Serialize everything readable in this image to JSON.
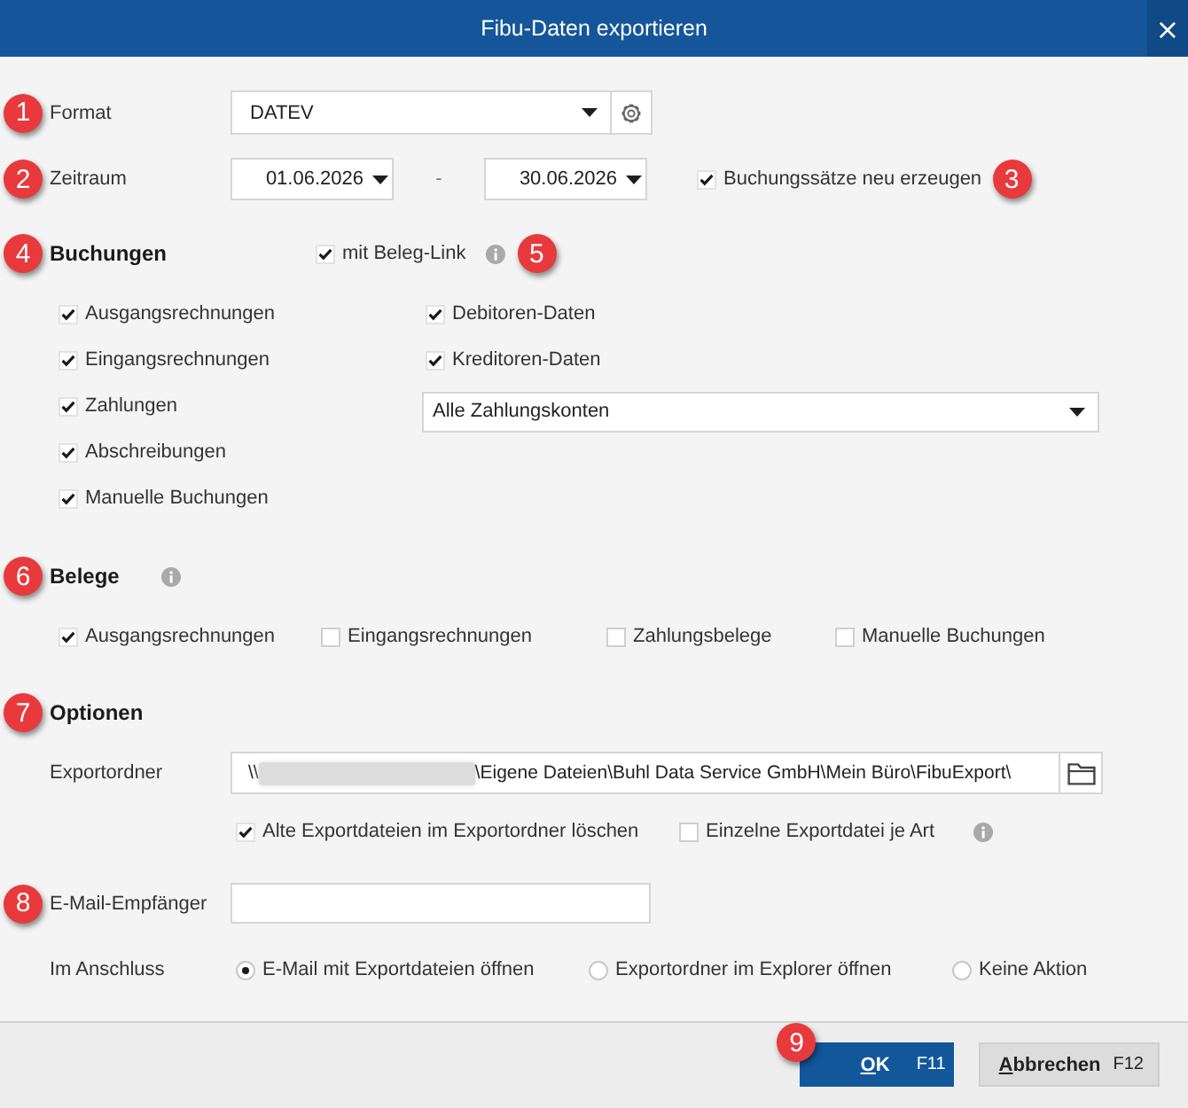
{
  "window": {
    "title": "Fibu-Daten exportieren",
    "close": "×"
  },
  "format": {
    "callout": "1",
    "label": "Format",
    "value": "DATEV"
  },
  "period": {
    "callout": "2",
    "label": "Zeitraum",
    "from": "01.06.2026",
    "separator": "-",
    "to": "30.06.2026",
    "regenerate": {
      "label": "Buchungssätze neu erzeugen",
      "checked": true,
      "callout": "3"
    }
  },
  "bookings": {
    "callout": "4",
    "heading": "Buchungen",
    "beleg_link": {
      "label": "mit Beleg-Link",
      "checked": true,
      "info": true,
      "callout": "5"
    },
    "left": [
      {
        "label": "Ausgangsrechnungen",
        "checked": true
      },
      {
        "label": "Eingangsrechnungen",
        "checked": true
      },
      {
        "label": "Zahlungen",
        "checked": true
      },
      {
        "label": "Abschreibungen",
        "checked": true
      },
      {
        "label": "Manuelle Buchungen",
        "checked": true
      }
    ],
    "right": [
      {
        "kind": "checkbox",
        "label": "Debitoren-Daten",
        "checked": true
      },
      {
        "kind": "checkbox",
        "label": "Kreditoren-Daten",
        "checked": true
      },
      {
        "kind": "dropdown",
        "value": "Alle Zahlungskonten"
      }
    ]
  },
  "documents": {
    "callout": "6",
    "heading": "Belege",
    "info": true,
    "items": [
      {
        "label": "Ausgangsrechnungen",
        "checked": true
      },
      {
        "label": "Eingangsrechnungen",
        "checked": false
      },
      {
        "label": "Zahlungsbelege",
        "checked": false
      },
      {
        "label": "Manuelle Buchungen",
        "checked": false
      }
    ]
  },
  "options": {
    "callout": "7",
    "heading": "Optionen",
    "export_folder": {
      "label": "Exportordner",
      "value_start": "\\\\",
      "blurred": true,
      "value_end": "\\Eigene Dateien\\Buhl Data Service GmbH\\Mein Büro\\FibuExport\\"
    },
    "checks": [
      {
        "label": "Alte Exportdateien im Exportordner löschen",
        "checked": true,
        "info": false
      },
      {
        "label": "Einzelne Exportdatei je Art",
        "checked": false,
        "info": true
      }
    ]
  },
  "email": {
    "callout": "8",
    "label": "E-Mail-Empfänger"
  },
  "after": {
    "label": "Im Anschluss",
    "options": [
      {
        "label": "E-Mail mit Exportdateien öffnen",
        "selected": true
      },
      {
        "label": "Exportordner im Explorer öffnen",
        "selected": false
      },
      {
        "label": "Keine Aktion",
        "selected": false
      }
    ]
  },
  "buttons": [
    {
      "kind": "primary",
      "mnemonic": "O",
      "rest": "K",
      "shortcut": "F11",
      "callout": "9"
    },
    {
      "kind": "secondary",
      "mnemonic": "A",
      "rest": "bbrechen",
      "shortcut": "F12"
    }
  ]
}
